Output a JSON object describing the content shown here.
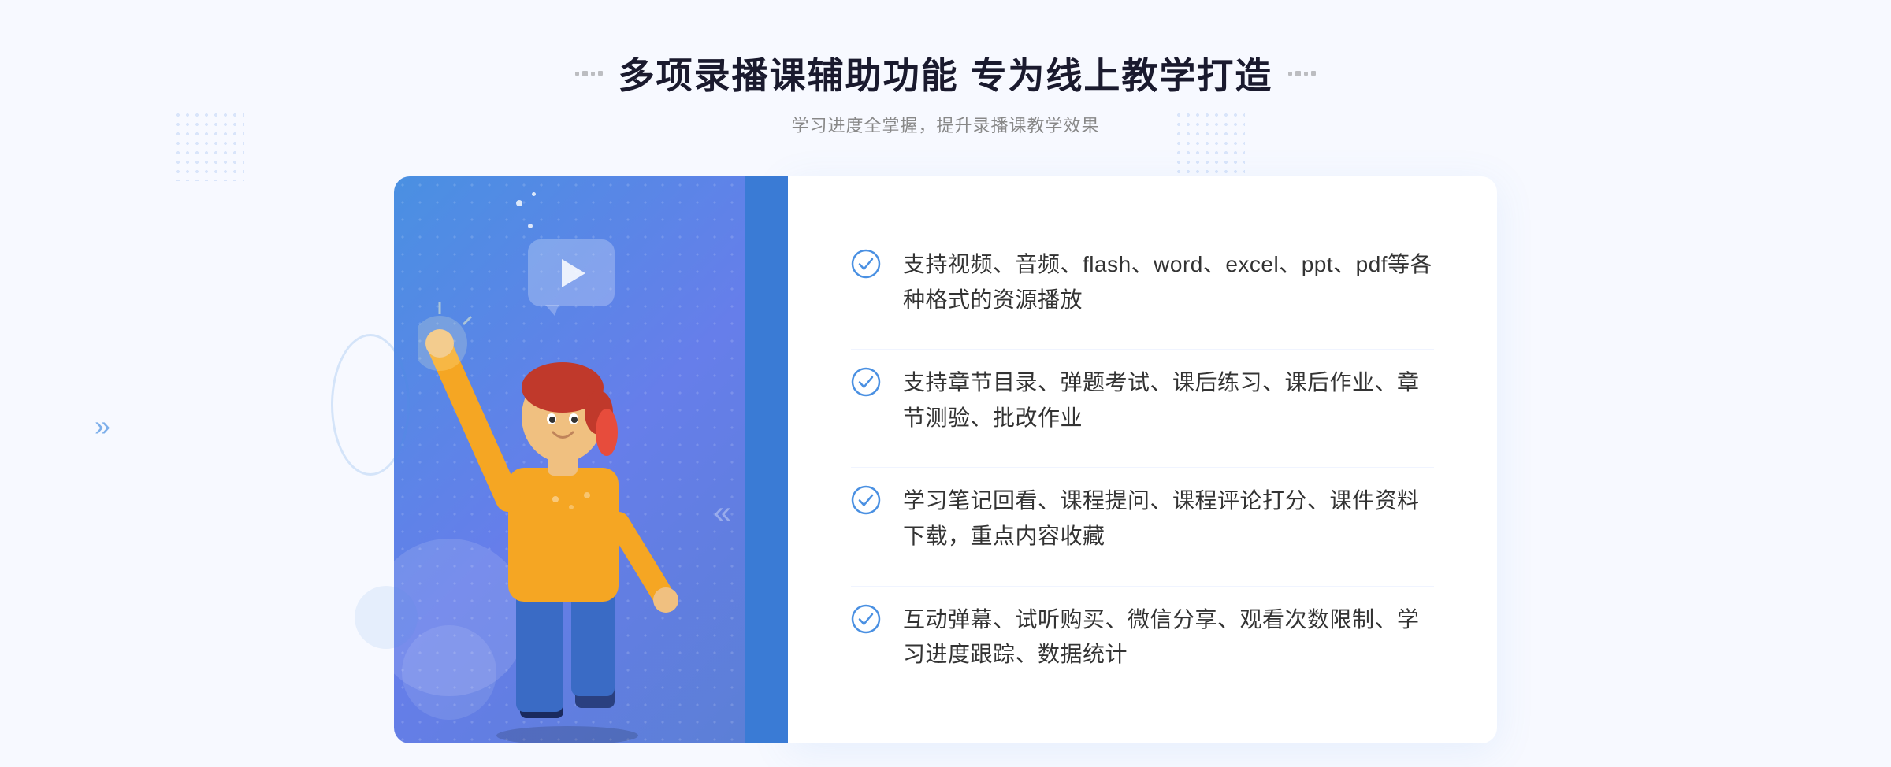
{
  "page": {
    "background_color": "#f7f9ff"
  },
  "header": {
    "title": "多项录播课辅助功能 专为线上教学打造",
    "subtitle": "学习进度全掌握，提升录播课教学效果",
    "title_part1": "多项录播课辅助功能 专为线上教学打造",
    "subtitle_text": "学习进度全掌握，提升录播课教学效果"
  },
  "features": [
    {
      "id": 1,
      "text": "支持视频、音频、flash、word、excel、ppt、pdf等各种格式的资源播放"
    },
    {
      "id": 2,
      "text": "支持章节目录、弹题考试、课后练习、课后作业、章节测验、批改作业"
    },
    {
      "id": 3,
      "text": "学习笔记回看、课程提问、课程评论打分、课件资料下载，重点内容收藏"
    },
    {
      "id": 4,
      "text": "互动弹幕、试听购买、微信分享、观看次数限制、学习进度跟踪、数据统计"
    }
  ],
  "icons": {
    "check": "check-circle-icon",
    "play": "play-icon",
    "chevron": "chevron-right-icon"
  },
  "colors": {
    "primary": "#4a90e2",
    "title": "#1a1a2e",
    "text": "#333333",
    "subtitle": "#888888",
    "white": "#ffffff",
    "panel_bg": "#ffffff",
    "gradient_start": "#4a90e2",
    "gradient_end": "#5b7fd4"
  }
}
